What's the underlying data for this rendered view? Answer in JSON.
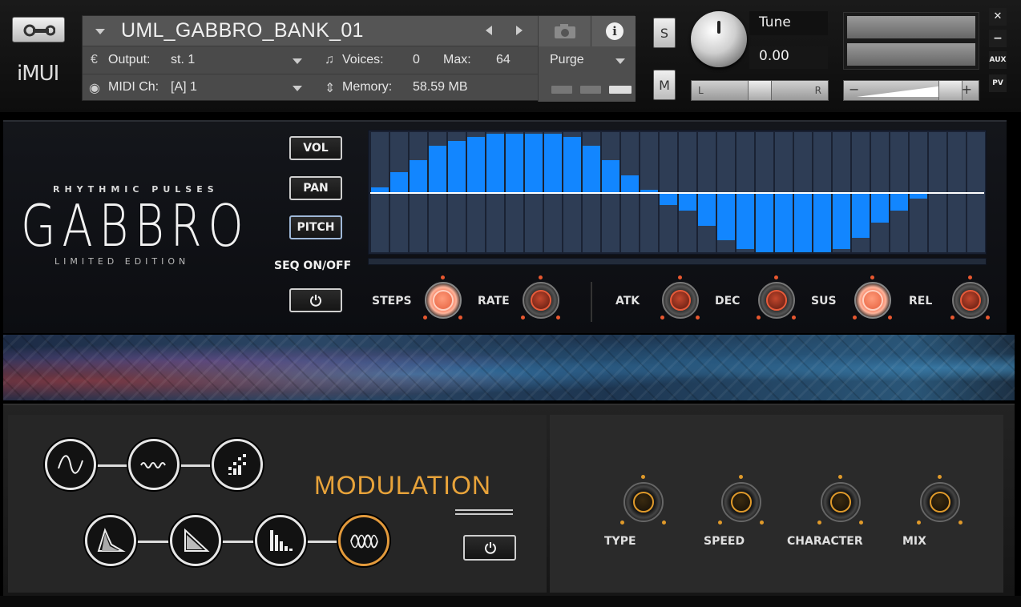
{
  "header": {
    "instrument_name": "UML_GABBRO_BANK_01",
    "output_label": "Output:",
    "output_value": "st. 1",
    "voices_label": "Voices:",
    "voices_value": "0",
    "max_label": "Max:",
    "max_value": "64",
    "purge_label": "Purge",
    "midi_label": "MIDI Ch:",
    "midi_value": "[A]  1",
    "memory_label": "Memory:",
    "memory_value": "58.59 MB",
    "solo_label": "S",
    "mute_label": "M",
    "tune_label": "Tune",
    "tune_value": "0.00",
    "pan_left": "L",
    "pan_right": "R",
    "vol_minus": "−",
    "vol_plus": "+",
    "close_label": "✕",
    "minimize_label": "−",
    "aux_label": "AUX",
    "pv_label": "PV",
    "logo_text": "iMUI"
  },
  "sequencer": {
    "logo_subtitle": "RHYTHMIC PULSES",
    "logo_title": "GABBRO",
    "logo_edition": "LIMITED EDITION",
    "buttons": [
      {
        "label": "VOL"
      },
      {
        "label": "PAN"
      },
      {
        "label": "PITCH"
      }
    ],
    "active_button": "PITCH",
    "seq_onoff_label": "SEQ ON/OFF",
    "step_values": [
      0.1,
      0.35,
      0.55,
      0.8,
      0.88,
      0.95,
      1.0,
      1.0,
      1.0,
      1.0,
      0.95,
      0.8,
      0.55,
      0.3,
      0.05,
      -0.2,
      -0.3,
      -0.55,
      -0.8,
      -0.95,
      -1.0,
      -1.0,
      -1.0,
      -1.0,
      -0.95,
      -0.75,
      -0.5,
      -0.3,
      -0.1,
      0,
      0,
      0
    ],
    "knobs": [
      {
        "label": "STEPS",
        "hot": true
      },
      {
        "label": "RATE",
        "hot": false
      },
      {
        "label": "ATK",
        "hot": false
      },
      {
        "label": "DEC",
        "hot": false
      },
      {
        "label": "SUS",
        "hot": true
      },
      {
        "label": "REL",
        "hot": false
      }
    ]
  },
  "modulation": {
    "title": "MODULATION",
    "shapes_row1": [
      "sine-wave-icon",
      "random-wave-icon",
      "noise-icon"
    ],
    "shapes_row2": [
      "envelope-icon",
      "decay-icon",
      "steps-icon",
      "loop-icon"
    ],
    "active_shape": "loop-icon",
    "knobs": [
      {
        "label": "TYPE"
      },
      {
        "label": "SPEED"
      },
      {
        "label": "CHARACTER"
      },
      {
        "label": "MIX"
      }
    ]
  },
  "colors": {
    "sequencer_bar": "#1286ff",
    "accent_orange": "#e8a33a",
    "knob_red": "#e8572f"
  }
}
